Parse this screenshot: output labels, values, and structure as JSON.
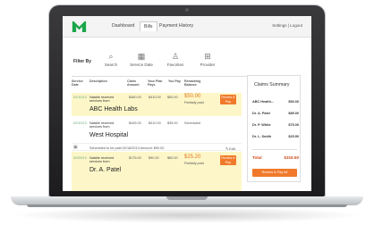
{
  "nav": {
    "tabs": [
      "Dashboard",
      "Bills",
      "Payment History"
    ],
    "active_tab": "Bills",
    "links": "Settings  |  Logout"
  },
  "filter": {
    "label": "Filter By",
    "items": [
      "Search",
      "Service Date",
      "Favorites",
      "Provider"
    ]
  },
  "table": {
    "headers": [
      "Service Date",
      "Description",
      "Claim Amount",
      "Your Plan Pays",
      "You Pay",
      "Remaining Balance"
    ],
    "rows": [
      {
        "date": "02/10/13",
        "desc": "Natalie received services from",
        "provider": "ABC Health Labs",
        "claim": "$460.00",
        "plan": "$410.00",
        "you_pay": "$50.00",
        "balance": "$50.00",
        "status": "Partially paid",
        "action": "Review & Pay"
      },
      {
        "date": "02/10/13",
        "desc": "Natalie received services from",
        "provider": "West Hospital",
        "claim": "$445.00",
        "plan": "$410.00",
        "you_pay": "$35.00",
        "balance": "Scheduled",
        "status": "",
        "action": ""
      },
      {
        "date": "02/09/13",
        "desc": "Natalie received services from",
        "provider": "Dr. A. Patel",
        "claim": "$175.00",
        "plan": "$90.00",
        "you_pay": "$60.00",
        "balance": "$25.20",
        "status": "Partially paid",
        "action": "Review & Pay"
      }
    ],
    "scheduled_note": "Scheduled to be paid 02/18/2013  Amount: $90.00",
    "edit_label": "Edit"
  },
  "summary": {
    "title": "Claims Summary",
    "items": [
      {
        "label": "ABC Health...",
        "value": "$50.00"
      },
      {
        "label": "Dr. A. Patel",
        "value": "$85.00"
      },
      {
        "label": "Dr. P. White",
        "value": "$75.00"
      },
      {
        "label": "Dr. L. Smith",
        "value": "$25.50"
      }
    ],
    "total_label": "Total",
    "total_value": "$316.50",
    "button": "Review & Pay All"
  },
  "colors": {
    "accent": "#f07a2a",
    "highlight": "#fdf6c8",
    "logo": "#1aa64a"
  }
}
